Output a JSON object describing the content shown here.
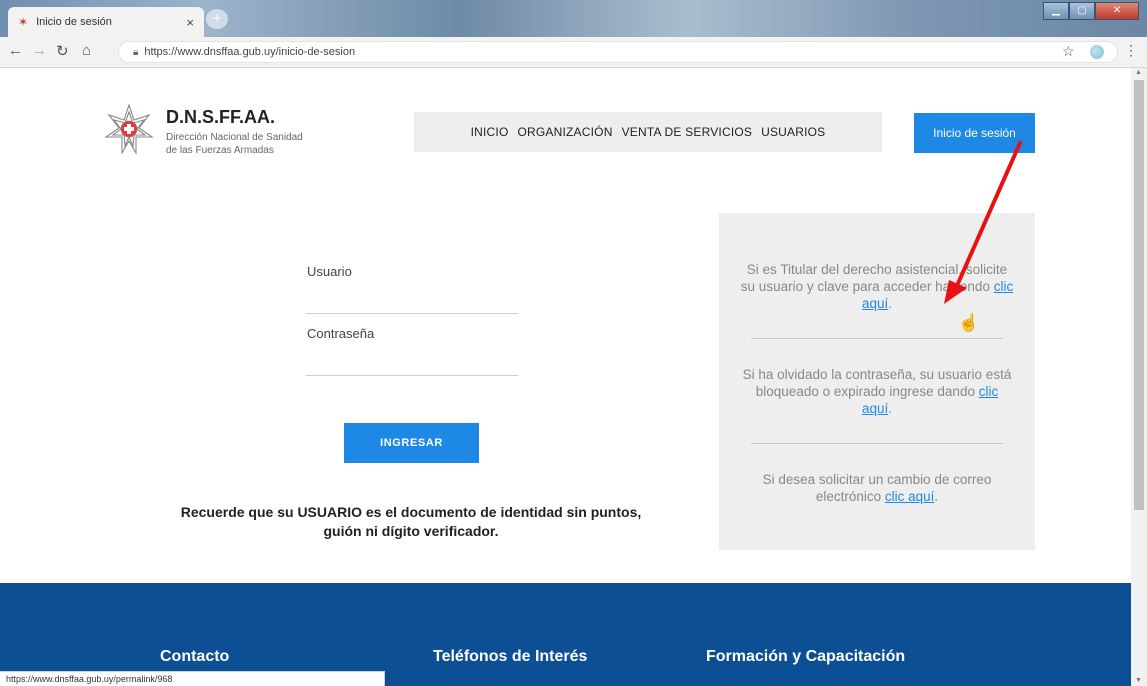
{
  "browser": {
    "tab_title": "Inicio de sesión",
    "tab_close": "×",
    "new_tab": "+",
    "url": "https://www.dnsffaa.gub.uy/inicio-de-sesion",
    "status_url": "https://www.dnsffaa.gub.uy/permalink/968"
  },
  "header": {
    "brand": "D.N.S.FF.AA.",
    "subtitle_line1": "Dirección Nacional de Sanidad",
    "subtitle_line2": "de las Fuerzas Armadas",
    "nav": [
      "INICIO",
      "ORGANIZACIÓN",
      "VENTA DE SERVICIOS",
      "USUARIOS"
    ],
    "login_button": "Inicio de sesión"
  },
  "form": {
    "usuario_label": "Usuario",
    "password_label": "Contraseña",
    "submit_label": "INGRESAR",
    "reminder": "Recuerde que su USUARIO es el documento de identidad sin puntos, guión ni dígito verificador."
  },
  "info": [
    {
      "text": "Si es Titular del derecho asistencial, solicite su usuario y clave para acceder haciendo ",
      "link": "clic aquí",
      "suffix": "."
    },
    {
      "text": "Si ha olvidado la contraseña, su usuario está bloqueado o expirado ingrese dando ",
      "link": "clic aquí",
      "suffix": "."
    },
    {
      "text": "Si desea solicitar un cambio de correo electrónico ",
      "link": "clic aquí",
      "suffix": "."
    }
  ],
  "footer": {
    "col1": "Contacto",
    "col2": "Teléfonos de Interés",
    "col3": "Formación y Capacitación"
  },
  "colors": {
    "accent": "#1e88e5",
    "footer": "#0d4f95",
    "annotation_arrow": "#e81010"
  }
}
